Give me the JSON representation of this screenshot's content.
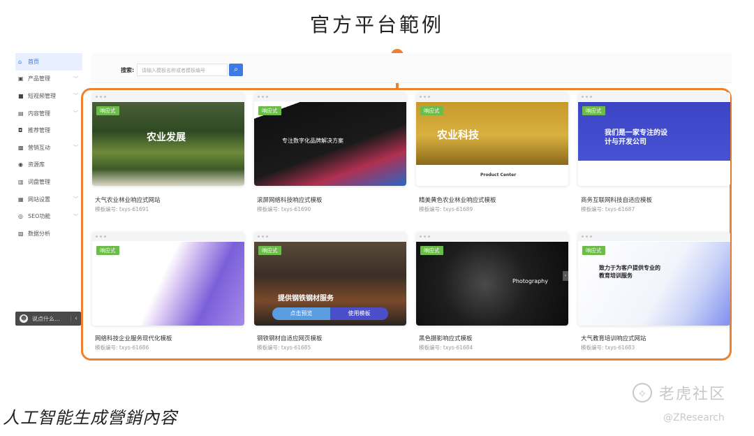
{
  "heading": "官方平台範例",
  "caption": "人工智能生成營銷內容",
  "watermark": {
    "name": "老虎社区",
    "handle": "@ZResearch"
  },
  "accent_color": "#ee8130",
  "sidebar": {
    "items": [
      {
        "icon": "home-icon",
        "glyph": "⌂",
        "label": "首页",
        "active": true,
        "expandable": false
      },
      {
        "icon": "product-icon",
        "glyph": "▣",
        "label": "产品管理",
        "active": false,
        "expandable": true
      },
      {
        "icon": "video-icon",
        "glyph": "■",
        "label": "短视频管理",
        "active": false,
        "expandable": true
      },
      {
        "icon": "content-icon",
        "glyph": "▤",
        "label": "内容管理",
        "active": false,
        "expandable": true
      },
      {
        "icon": "recommend-icon",
        "glyph": "◘",
        "label": "推荐管理",
        "active": false,
        "expandable": false
      },
      {
        "icon": "marketing-icon",
        "glyph": "▩",
        "label": "营销互动",
        "active": false,
        "expandable": true
      },
      {
        "icon": "resource-icon",
        "glyph": "◉",
        "label": "资源库",
        "active": false,
        "expandable": false
      },
      {
        "icon": "vocabulary-icon",
        "glyph": "▥",
        "label": "词盘管理",
        "active": false,
        "expandable": false
      },
      {
        "icon": "settings-icon",
        "glyph": "▦",
        "label": "网站设置",
        "active": false,
        "expandable": true
      },
      {
        "icon": "seo-icon",
        "glyph": "◎",
        "label": "SEO功能",
        "active": false,
        "expandable": true
      },
      {
        "icon": "analytics-icon",
        "glyph": "▧",
        "label": "数据分析",
        "active": false,
        "expandable": false
      }
    ],
    "chat": {
      "placeholder": "说点什么...",
      "collapse": "‹"
    }
  },
  "search": {
    "label": "搜索:",
    "placeholder": "请输入模板名称或者模板编号",
    "button_icon": "search-icon"
  },
  "code_label": "模板编号:",
  "responsive_badge": "响应式",
  "templates": [
    {
      "name": "大气农业林业响应式网站",
      "code": "txys-61691",
      "shot_text": "农业发展"
    },
    {
      "name": "滚屏网络科技响应式模板",
      "code": "txys-61690",
      "shot_text": "专注数字化品牌解决方案"
    },
    {
      "name": "精美黄色农业林业响应式模板",
      "code": "txys-61689",
      "shot_text": "农业科技",
      "shot_sub": "Product Center"
    },
    {
      "name": "商务互联网科技自适应模板",
      "code": "txys-61687",
      "shot_text": "我们是一家专注的设计与开发公司"
    },
    {
      "name": "网络科技企业服务现代化模板",
      "code": "txys-61686",
      "shot_text": ""
    },
    {
      "name": "钢铁钢材自适应网页模板",
      "code": "txys-61685",
      "shot_text": "提供钢铁钢材服务",
      "hover": {
        "preview": "点击预览",
        "use": "使用模板"
      }
    },
    {
      "name": "黑色摄影响应式模板",
      "code": "txys-61684",
      "shot_text": "Photography"
    },
    {
      "name": "大气教育培训响应式网站",
      "code": "txys-61683",
      "shot_text": "致力于为客户提供专业的教育培训服务"
    }
  ]
}
